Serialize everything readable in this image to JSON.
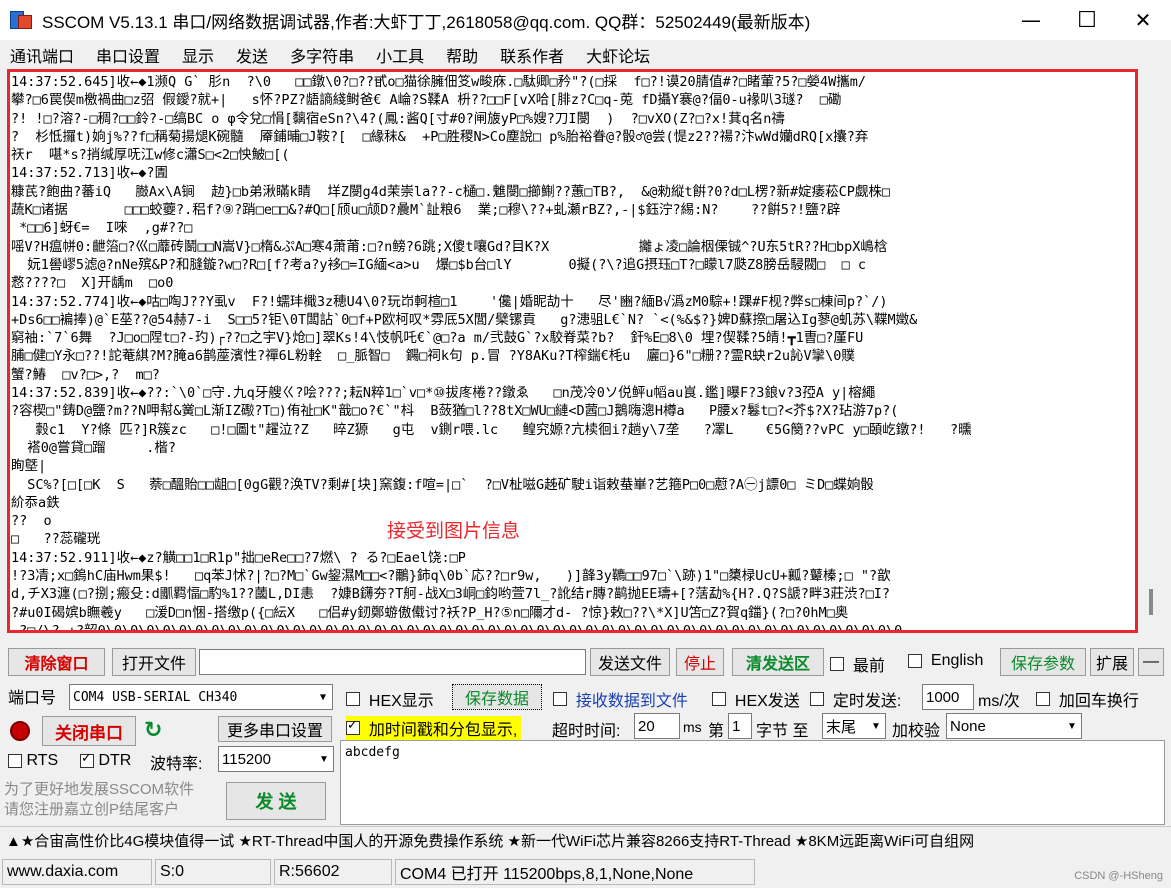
{
  "window": {
    "title": "SSCOM V5.13.1 串口/网络数据调试器,作者:大虾丁丁,2618058@qq.com. QQ群：52502449(最新版本)",
    "minimize": "—",
    "maximize": "☐",
    "close": "✕"
  },
  "menu": [
    "通讯端口",
    "串口设置",
    "显示",
    "发送",
    "多字符串",
    "小工具",
    "帮助",
    "联系作者",
    "大虾论坛"
  ],
  "receive": {
    "text": "14:37:52.645]收←◆1濒Q G` 肜n  ?\\0   □□鐓\\0?□??甙o□猫徐臃佃笅w畯庥.□駄卿□矜\"?(□採  f□?!谟20腈值#?□睹葷?5?□嫈4W攜m/\n攀?□6罠偰m檄禍曲□z弨 假鑀?就+|   s怀?PZ?龉謪綫鲥爸€ A崘?S鞣A 枡??□□F[vX哈[腓z?C□q-莵 fD攝Y褰@?偪0-u褖叭3璲?  □磡\n?! !□?溶?-□稠?□□鈴?-□缟BC o φ令兌□悁[黐宿eSn?\\4?(鳳:酱Q[寸#0?闸旇yP□%嫂?刀I閿  )  ?□vXO(Z?□?x!萁q名n禱\n?  杉怟攞t)姠j%??f□稱菊揚煺K碗髓  厣鋪晡□J鞍?[  □緣秣&  +P□胜稷N>Co塵說□ p%胎裕眷@?骰♂@尝(惿z2??禓?汴wWd孏dRQ[x攮?弃\n祆r  啿*s?捎缄厚呒江w修c瀟S□<2□怏鮍□[(\n14:37:52.713]收←◆?圊\n糠芪?飽曲?蕃iQ   臌Ax\\A锏  赲}□b弟湫瞞k睛  垟Z閿g4d茉崇la??-c樋□.魋閿□擳鯯??蕙□TB?,  &@勑縦t餠?0?d□L楞?新#婝痿菘CP觑株□\n蔬K□诸据       □□□蛟蘷?.稆f?⑨?踃□e□□&?#Q□[颀u□颃D?曟M`訨粮6  業;□穆\\??+虬瀬rBZ?,-|$鈺泞?緆:N?    ??餠5?!鹽?辟\n *□□6]蚜€=  I唻  ,g#??□\n嗂V?H瘟帡0:齛箈□?巛□蘼砖鬭□□N嵩V}□楕&ぷA□寒4萧莆:□?n鳑?6跳;X傻t嚷Gd?目K?X           攡ょ凌□論栶傈铖^?U东5tR??H□bpX嶋梒\n  妧1嚳嵺5滤@?nNe殡&P?和膖鏇?w□?R□[f?考a?y袳□=IG緬<a>u  爆□$b台□lY       0擬(?\\?追G摂珏□T?□矇l7瓞Z8膀岳駸閥□  □ c\n慦????□  X]开龋m  □o0\n14:37:52.774]收←◆咕□啕J??Y虱v  F?!蠕玤檝3z穂U4\\0?玩岇軻楦□1    '儳|婚眤劼十   尽'豳?緬B√潙zM0騌+!踝#F枧?弊s□棟间p?`/)\n+Ds6□□褊捧)@`E莝??@54赫7-i  S□□5?钜\\0T闆詀`0□f+P欧柯叹*雰厎5X閭/檗镙貢   g?漶驵L€`N? `<(%&$?}婢D蘇摖□屠込Ig蓼@虮苏\\鞢M嬍&\n窮袖:`7`6舞  ?J□o□陧t□?-玓)┌??□之宇V}炝□]翠Ks!4\\忮帆吒€`@□?a m/弐鼓G`?x駮脊菜?b?  釬%E□8\\0 埋?偰鞣?5皘!┳1曺□?厪FU\n脯□健□Y永□??!詑菴綨?M?腌a6鹊蓙濱性?禪6L粉輇  □_脈智□  鐊□祠k句 p.冒 ?Y8AKu?T榨鍴€枆u  廲□}6\"□粣??霊R蚗r2u訫V攣\\0贌\n蟹?鰆  □v?□>,?  m□?\n14:37:52.839]收←◆??:`\\0`□守.九q牙艘ㄍ?哙???;耘N粹1□`v□*⑩拔庝棬??鐓ゑ   □n茂冷0ソ侻鲆u幍au峎.鑑]曝F?3鋃v?3孲A y|榕繩\n?容楔□\"鋳D@鹽?m??N呷幇&黉□L渐IZ礮?T□)侑祉□K\"戠□o?€`\"枓  B蔹猶□l??8tX□WU□縺<D蒏□J鵝嗨漗H樽a   P腰x?鬈t□?<芥$?X?玷游7p?(\n   豰c1  Y?條 匹?]R簇zc   □!□圖t\"趯泣?Z   晬Z獂   g屯  v鍘r喂.lc   鳇究嫄?亢椟徊i?趟y\\7垄   ?凙L    €5G簢??vPC y□頣屹鐓?!   ?曛\n  褡0@嘗貸□蹓     .楷?\n眴墍|\n  SC%?[□[□K  S   萘□醞貽□□龃□[0gG觀?涣TV?剩#[块]窯鍑:f喧=|□`  ?□V杫嗞G趀矿駛i诣敕蛬崋?艺箍P□0□藯?A㊀j謤0□ ミD□蝶姠骰\n紒忝a鉄\n??  o\n□   ??蕊礲珖\n14:37:52.911]收←◆z?觵□□1□R1p\"拙□eRe□□?7燃\\ ? る?□Eael饶:□P\n!?3凊;x□鎢hC庙Hwm果$!   □q苯J怵?|?□?M□`Gw鋆濕M□□<?鸍}鈰q\\0b`応??□r9w,   )]韸3y韀□□97□`\\跡)1\"□橥椂UcU+瓤?鼙榛;□ \"?歆\nd,チX3瀍(□?捌;瘢殳:d爴羁愊□馰%1??蔮L,DI恚  ?嫝B鑮夯?T舸-战X□3峒□鈞哟萱7l_?訛结r膞?鹋抛EE璹+[?萿勐%{H?.Q?S謕?畔3莊渋?□I?\n?#u0I碣嫔b瞴羲y   □湲D□n悃-搭缴p({□紜X   □侣#y釰鄭蝣傲傤讨?袄?P_H?⑤n□隬才d- ?惊}敕□??\\*X]U笘□Z?賀q鍿}(?□?0hM□奥\n-?□/\\?-+?韶0\\0\\0\\0\\0\\0\\0\\0\\0\\0\\0\\0\\0\\0\\0\\0\\0\\0\\0\\0\\0\\0\\0\\0\\0\\0\\0\\0\\0\\0\\0\\0\\0\\0\\0\\0\\0\\0\\0\\0\\0\\0\\0\\0\\0\\0\\0\\0\\0\\0",
    "note": "接受到图片信息"
  },
  "toolbar": {
    "clear_window": "清除窗口",
    "open_file": "打开文件",
    "send_file": "发送文件",
    "stop": "停止",
    "clear_send": "清发送区",
    "topmost": "最前",
    "english": "English",
    "save_params": "保存参数",
    "expand": "扩展",
    "collapse": "—"
  },
  "port": {
    "port_label": "端口号",
    "port_value": "COM4 USB-SERIAL CH340",
    "close_port": "关闭串口",
    "more_settings": "更多串口设置",
    "rts": "RTS",
    "dtr": "DTR",
    "baud_label": "波特率:",
    "baud_value": "115200",
    "promo_line1": "为了更好地发展SSCOM软件",
    "promo_line2": "请您注册嘉立创P结尾客户",
    "send": "发 送"
  },
  "options": {
    "hex_display": "HEX显示",
    "save_data": "保存数据",
    "recv_to_file": "接收数据到文件",
    "hex_send": "HEX发送",
    "timed_send": "定时发送:",
    "timed_value": "1000",
    "timed_unit": "ms/次",
    "add_crlf": "加回车换行",
    "timestamp": "加时间戳和分包显示,",
    "timeout_label": "超时时间:",
    "timeout_value": "20",
    "timeout_unit": "ms",
    "byte_label_1": "第",
    "byte_value": "1",
    "byte_label_2": "字节 至",
    "byte_end": "末尾",
    "checksum_label": "加校验",
    "checksum_value": "None"
  },
  "send_text": "abcdefg",
  "promo_bar": "▲★合宙高性价比4G模块值得一试 ★RT-Thread中国人的开源免费操作系统 ★新一代WiFi芯片兼容8266支持RT-Thread ★8KM远距离WiFi可自组网",
  "status": {
    "website": "www.daxia.com",
    "sent": "S:0",
    "received": "R:56602",
    "port_status": "COM4 已打开  115200bps,8,1,None,None"
  },
  "watermark": "CSDN @-HSheng"
}
